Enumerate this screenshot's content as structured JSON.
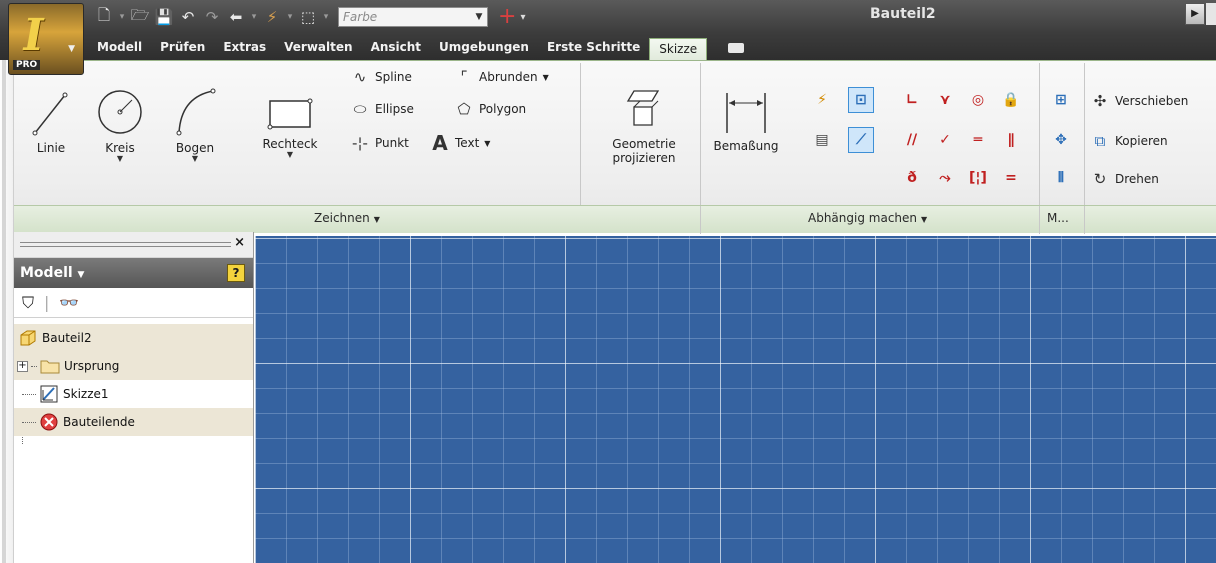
{
  "window": {
    "title": "Bauteil2"
  },
  "app_button": {
    "badge": "PRO"
  },
  "quick_access": {
    "color_placeholder": "Farbe",
    "icons": [
      "new-icon",
      "open-icon",
      "save-icon",
      "undo-icon",
      "redo-icon",
      "return-icon",
      "update-icon",
      "select-icon"
    ]
  },
  "tabs": [
    {
      "label": "Modell",
      "active": false
    },
    {
      "label": "Prüfen",
      "active": false
    },
    {
      "label": "Extras",
      "active": false
    },
    {
      "label": "Verwalten",
      "active": false
    },
    {
      "label": "Ansicht",
      "active": false
    },
    {
      "label": "Umgebungen",
      "active": false
    },
    {
      "label": "Erste Schritte",
      "active": false
    },
    {
      "label": "Skizze",
      "active": true
    }
  ],
  "ribbon": {
    "zeichnen": {
      "label": "Zeichnen",
      "linie": "Linie",
      "kreis": "Kreis",
      "bogen": "Bogen",
      "rechteck": "Rechteck",
      "spline": "Spline",
      "ellipse": "Ellipse",
      "punkt": "Punkt",
      "abrunden": "Abrunden",
      "polygon": "Polygon",
      "text": "Text"
    },
    "geometrie": {
      "line1": "Geometrie",
      "line2": "projizieren"
    },
    "abhaengig": {
      "label": "Abhängig machen",
      "bemassung": "Bemaßung"
    },
    "modify": {
      "label": "M...",
      "verschieben": "Verschieben",
      "kopieren": "Kopieren",
      "drehen": "Drehen"
    }
  },
  "browser": {
    "title": "Modell",
    "help": "?",
    "tree": {
      "root": "Bauteil2",
      "origin": "Ursprung",
      "sketch": "Skizze1",
      "end": "Bauteilende"
    }
  },
  "colors": {
    "canvas": "#3562a0",
    "ribbon_active": "#dfe9da",
    "title_bar": "#3c3c3c"
  }
}
